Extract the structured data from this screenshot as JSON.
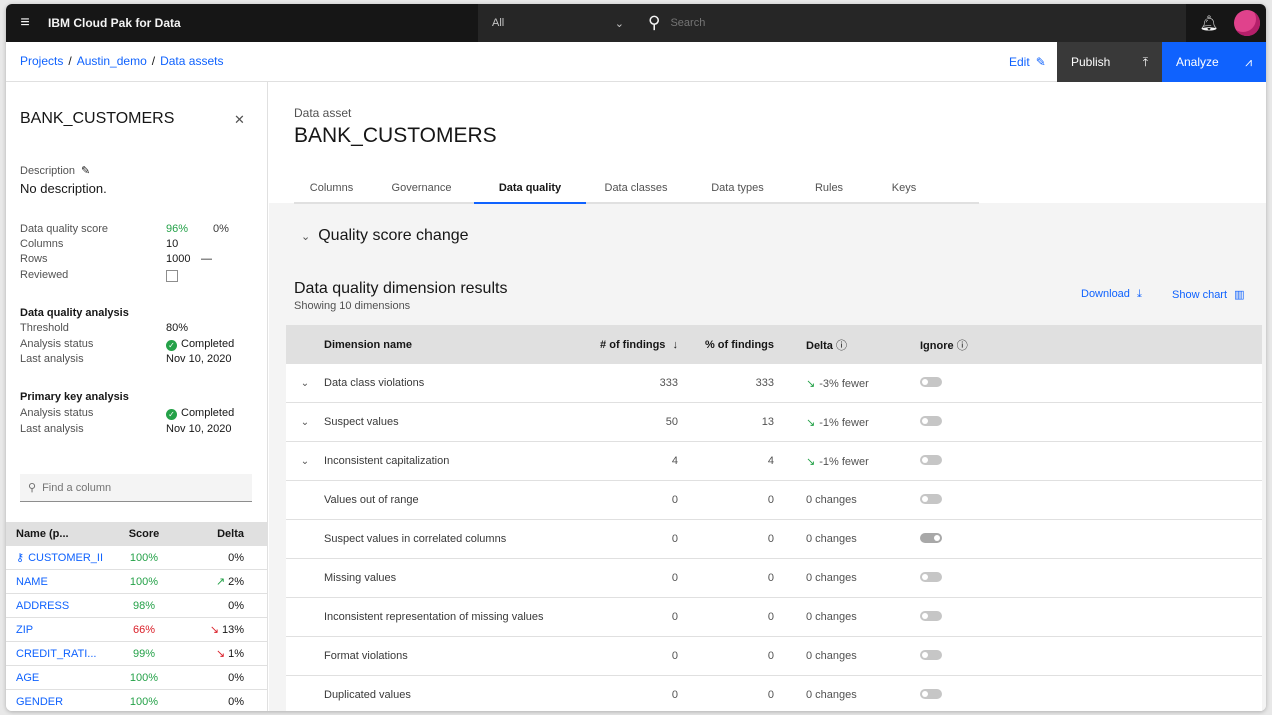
{
  "header": {
    "brand": "IBM Cloud Pak for Data",
    "scope": "All",
    "search_placeholder": "Search"
  },
  "breadcrumb": [
    "Projects",
    "Austin_demo",
    "Data assets"
  ],
  "actions": {
    "edit": "Edit",
    "publish": "Publish",
    "analyze": "Analyze"
  },
  "left_panel": {
    "title": "BANK_CUSTOMERS",
    "description_label": "Description",
    "description_value": "No description.",
    "dq_score_label": "Data quality score",
    "dq_score_value": "96%",
    "dq_score_delta": "0%",
    "columns_label": "Columns",
    "columns_value": "10",
    "rows_label": "Rows",
    "rows_value": "1000",
    "rows_delta": "—",
    "reviewed_label": "Reviewed",
    "dqa_section": "Data quality analysis",
    "threshold_label": "Threshold",
    "threshold_value": "80%",
    "dqa_status_label": "Analysis status",
    "dqa_status_value": "Completed",
    "dqa_last_label": "Last analysis",
    "dqa_last_value": "Nov 10, 2020",
    "pka_section": "Primary key analysis",
    "pka_status_label": "Analysis status",
    "pka_status_value": "Completed",
    "pka_last_label": "Last analysis",
    "pka_last_value": "Nov 10, 2020",
    "find_placeholder": "Find a column",
    "col_headers": {
      "name": "Name (p...",
      "score": "Score",
      "delta": "Delta"
    },
    "columns": [
      {
        "name": "CUSTOMER_II",
        "score": "100%",
        "delta": "0%",
        "trend": "none"
      },
      {
        "name": "NAME",
        "score": "100%",
        "delta": "2%",
        "trend": "up"
      },
      {
        "name": "ADDRESS",
        "score": "98%",
        "delta": "0%",
        "trend": "none"
      },
      {
        "name": "ZIP",
        "score": "66%",
        "delta": "13%",
        "trend": "down"
      },
      {
        "name": "CREDIT_RATI...",
        "score": "99%",
        "delta": "1%",
        "trend": "down"
      },
      {
        "name": "AGE",
        "score": "100%",
        "delta": "0%",
        "trend": "none"
      },
      {
        "name": "GENDER",
        "score": "100%",
        "delta": "0%",
        "trend": "none"
      }
    ]
  },
  "main": {
    "asset_label": "Data asset",
    "asset_title": "BANK_CUSTOMERS",
    "tabs": [
      "Columns",
      "Governance",
      "Data quality",
      "Data classes",
      "Data types",
      "Rules",
      "Keys"
    ],
    "active_tab": "Data quality",
    "quality_score_change": "Quality score change",
    "dqr_title": "Data quality dimension results",
    "dqr_subtitle": "Showing 10 dimensions",
    "download": "Download",
    "show_chart": "Show chart",
    "table_headers": {
      "name": "Dimension name",
      "findings": "# of findings",
      "pct": "% of findings",
      "delta": "Delta",
      "ignore": "Ignore"
    },
    "rows": [
      {
        "name": "Data class violations",
        "findings": "333",
        "pct": "333",
        "delta": "-3% fewer",
        "expandable": true,
        "ignore": false
      },
      {
        "name": "Suspect values",
        "findings": "50",
        "pct": "13",
        "delta": "-1% fewer",
        "expandable": true,
        "ignore": false
      },
      {
        "name": "Inconsistent capitalization",
        "findings": "4",
        "pct": "4",
        "delta": "-1% fewer",
        "expandable": true,
        "ignore": false
      },
      {
        "name": "Values out of range",
        "findings": "0",
        "pct": "0",
        "delta": "0 changes",
        "expandable": false,
        "ignore": false
      },
      {
        "name": "Suspect values in correlated columns",
        "findings": "0",
        "pct": "0",
        "delta": "0 changes",
        "expandable": false,
        "ignore": true
      },
      {
        "name": "Missing values",
        "findings": "0",
        "pct": "0",
        "delta": "0 changes",
        "expandable": false,
        "ignore": false
      },
      {
        "name": "Inconsistent representation of missing values",
        "findings": "0",
        "pct": "0",
        "delta": "0 changes",
        "expandable": false,
        "ignore": false
      },
      {
        "name": "Format violations",
        "findings": "0",
        "pct": "0",
        "delta": "0 changes",
        "expandable": false,
        "ignore": false
      },
      {
        "name": "Duplicated values",
        "findings": "0",
        "pct": "0",
        "delta": "0 changes",
        "expandable": false,
        "ignore": false
      }
    ]
  }
}
